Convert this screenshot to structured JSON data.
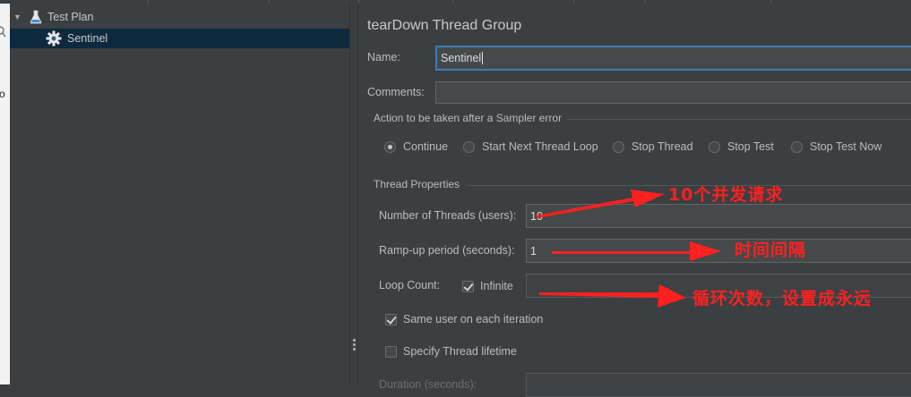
{
  "tree": {
    "items": [
      {
        "label": "Test Plan",
        "icon": "flask-icon"
      },
      {
        "label": "Sentinel",
        "icon": "gear-icon"
      }
    ]
  },
  "leftstrip": {
    "letter": "o"
  },
  "panel": {
    "title": "tearDown Thread Group",
    "name_label": "Name:",
    "name_value": "Sentinel",
    "comments_label": "Comments:",
    "comments_value": "",
    "error_group_title": "Action to be taken after a Sampler error",
    "error_actions": [
      {
        "label": "Continue",
        "selected": true
      },
      {
        "label": "Start Next Thread Loop",
        "selected": false
      },
      {
        "label": "Stop Thread",
        "selected": false
      },
      {
        "label": "Stop Test",
        "selected": false
      },
      {
        "label": "Stop Test Now",
        "selected": false
      }
    ],
    "thread_group_title": "Thread Properties",
    "threads_label": "Number of Threads (users):",
    "threads_value": "10",
    "rampup_label": "Ramp-up period (seconds):",
    "rampup_value": "1",
    "loop_label": "Loop Count:",
    "infinite_label": "Infinite",
    "infinite_checked": true,
    "loop_value": "",
    "same_user_label": "Same user on each iteration",
    "same_user_checked": true,
    "lifetime_label": "Specify Thread lifetime",
    "lifetime_checked": false,
    "duration_label": "Duration (seconds):"
  },
  "annotations": {
    "threads_note": "10个并发请求",
    "rampup_note": "时间间隔",
    "loop_note": "循环次数，设置成永远",
    "color": "#ff2020"
  }
}
